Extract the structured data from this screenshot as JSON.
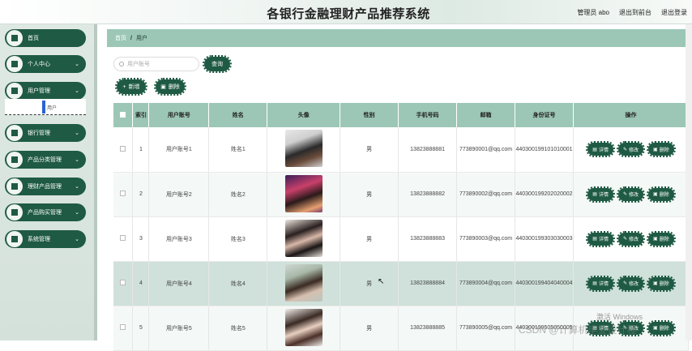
{
  "header": {
    "title": "各银行金融理财产品推荐系统",
    "user_label": "管理员 abo",
    "front_link": "退出到前台",
    "logout_link": "退出登录"
  },
  "sidebar": {
    "items": [
      {
        "label": "首页",
        "has_chevron": false
      },
      {
        "label": "个人中心",
        "has_chevron": true
      },
      {
        "label": "用户管理",
        "has_chevron": true
      },
      {
        "label": "银行管理",
        "has_chevron": true
      },
      {
        "label": "产品分类管理",
        "has_chevron": true
      },
      {
        "label": "理财产品管理",
        "has_chevron": true
      },
      {
        "label": "产品购买管理",
        "has_chevron": true
      },
      {
        "label": "系统管理",
        "has_chevron": true
      }
    ],
    "sub_item": "用户"
  },
  "breadcrumb": {
    "home": "首页",
    "sep": "/",
    "current": "用户"
  },
  "search": {
    "placeholder": "用户账号",
    "query_label": "查询"
  },
  "actions": {
    "add_label": "新增",
    "delete_label": "删除"
  },
  "table": {
    "columns": [
      "索引",
      "用户账号",
      "姓名",
      "头像",
      "性别",
      "手机号码",
      "邮箱",
      "身份证号",
      "操作"
    ],
    "ops": {
      "detail": "详情",
      "edit": "修改",
      "delete": "删除"
    },
    "rows": [
      {
        "index": "1",
        "account": "用户账号1",
        "name": "姓名1",
        "gender": "男",
        "phone": "13823888881",
        "email": "773890001@qq.com",
        "id_card": "440300199101010001"
      },
      {
        "index": "2",
        "account": "用户账号2",
        "name": "姓名2",
        "gender": "男",
        "phone": "13823888882",
        "email": "773890002@qq.com",
        "id_card": "440300199202020002"
      },
      {
        "index": "3",
        "account": "用户账号3",
        "name": "姓名3",
        "gender": "男",
        "phone": "13823888883",
        "email": "773890003@qq.com",
        "id_card": "440300199303030003"
      },
      {
        "index": "4",
        "account": "用户账号4",
        "name": "姓名4",
        "gender": "男",
        "phone": "13823888884",
        "email": "773890004@qq.com",
        "id_card": "440300199404040004"
      },
      {
        "index": "5",
        "account": "用户账号5",
        "name": "姓名5",
        "gender": "男",
        "phone": "13823888885",
        "email": "773890005@qq.com",
        "id_card": "440300199505050005"
      }
    ]
  },
  "overlay": {
    "watermark": "激活 Windows",
    "csdn": "CSDN @计算机毕业设计程"
  }
}
